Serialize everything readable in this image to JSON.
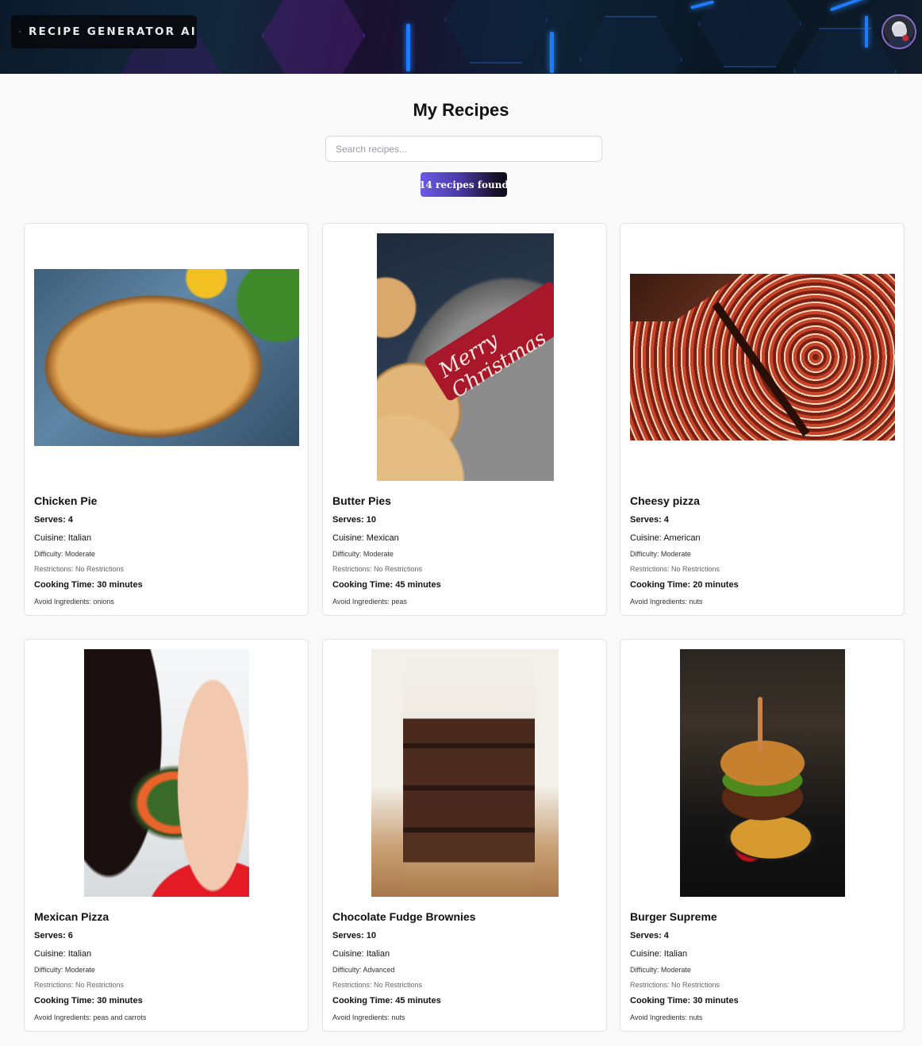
{
  "header": {
    "logo_text": "RECIPE GENERATOR AI",
    "logo_icon": "cube-logo-icon",
    "avatar": "user-avatar"
  },
  "page": {
    "title": "My Recipes",
    "search_placeholder": "Search recipes...",
    "search_value": "",
    "count_badge": "14 recipes found"
  },
  "recipes": [
    {
      "title": "Chicken Pie",
      "serves": "Serves: 4",
      "cuisine": "Cuisine: Italian",
      "difficulty": "Difficulty: Moderate",
      "restrictions": "Restrictions: No Restrictions",
      "cooking_time": "Cooking Time: 30 minutes",
      "avoid": "Avoid Ingredients: onions"
    },
    {
      "title": "Butter Pies",
      "serves": "Serves: 10",
      "cuisine": "Cuisine: Mexican",
      "difficulty": "Difficulty: Moderate",
      "restrictions": "Restrictions: No Restrictions",
      "cooking_time": "Cooking Time: 45 minutes",
      "avoid": "Avoid Ingredients: peas",
      "image_text": "Merry Christmas"
    },
    {
      "title": "Cheesy pizza",
      "serves": "Serves: 4",
      "cuisine": "Cuisine: American",
      "difficulty": "Difficulty: Moderate",
      "restrictions": "Restrictions: No Restrictions",
      "cooking_time": "Cooking Time: 20 minutes",
      "avoid": "Avoid Ingredients: nuts"
    },
    {
      "title": "Mexican Pizza",
      "serves": "Serves: 6",
      "cuisine": "Cuisine: Italian",
      "difficulty": "Difficulty: Moderate",
      "restrictions": "Restrictions: No Restrictions",
      "cooking_time": "Cooking Time: 30 minutes",
      "avoid": "Avoid Ingredients: peas and carrots"
    },
    {
      "title": "Chocolate Fudge Brownies",
      "serves": "Serves: 10",
      "cuisine": "Cuisine: Italian",
      "difficulty": "Difficulty: Advanced",
      "restrictions": "Restrictions: No Restrictions",
      "cooking_time": "Cooking Time: 45 minutes",
      "avoid": "Avoid Ingredients: nuts"
    },
    {
      "title": "Burger Supreme",
      "serves": "Serves: 4",
      "cuisine": "Cuisine: Italian",
      "difficulty": "Difficulty: Moderate",
      "restrictions": "Restrictions: No Restrictions",
      "cooking_time": "Cooking Time: 30 minutes",
      "avoid": "Avoid Ingredients: nuts"
    }
  ],
  "colors": {
    "page_bg": "#f9f9f9",
    "badge_gradient_start": "#6a5ae8",
    "badge_gradient_end": "#0b0b16",
    "card_border": "#e3e3e7",
    "avatar_ring": "#8a6cc8"
  }
}
